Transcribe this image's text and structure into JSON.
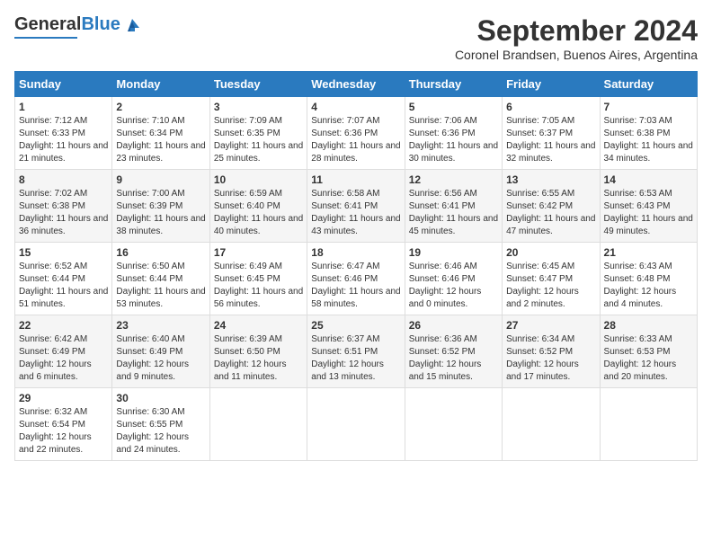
{
  "header": {
    "logo_general": "General",
    "logo_blue": "Blue",
    "title": "September 2024",
    "subtitle": "Coronel Brandsen, Buenos Aires, Argentina"
  },
  "calendar": {
    "days_of_week": [
      "Sunday",
      "Monday",
      "Tuesday",
      "Wednesday",
      "Thursday",
      "Friday",
      "Saturday"
    ],
    "weeks": [
      [
        {
          "day": "1",
          "sunrise": "7:12 AM",
          "sunset": "6:33 PM",
          "daylight": "11 hours and 21 minutes."
        },
        {
          "day": "2",
          "sunrise": "7:10 AM",
          "sunset": "6:34 PM",
          "daylight": "11 hours and 23 minutes."
        },
        {
          "day": "3",
          "sunrise": "7:09 AM",
          "sunset": "6:35 PM",
          "daylight": "11 hours and 25 minutes."
        },
        {
          "day": "4",
          "sunrise": "7:07 AM",
          "sunset": "6:36 PM",
          "daylight": "11 hours and 28 minutes."
        },
        {
          "day": "5",
          "sunrise": "7:06 AM",
          "sunset": "6:36 PM",
          "daylight": "11 hours and 30 minutes."
        },
        {
          "day": "6",
          "sunrise": "7:05 AM",
          "sunset": "6:37 PM",
          "daylight": "11 hours and 32 minutes."
        },
        {
          "day": "7",
          "sunrise": "7:03 AM",
          "sunset": "6:38 PM",
          "daylight": "11 hours and 34 minutes."
        }
      ],
      [
        {
          "day": "8",
          "sunrise": "7:02 AM",
          "sunset": "6:38 PM",
          "daylight": "11 hours and 36 minutes."
        },
        {
          "day": "9",
          "sunrise": "7:00 AM",
          "sunset": "6:39 PM",
          "daylight": "11 hours and 38 minutes."
        },
        {
          "day": "10",
          "sunrise": "6:59 AM",
          "sunset": "6:40 PM",
          "daylight": "11 hours and 40 minutes."
        },
        {
          "day": "11",
          "sunrise": "6:58 AM",
          "sunset": "6:41 PM",
          "daylight": "11 hours and 43 minutes."
        },
        {
          "day": "12",
          "sunrise": "6:56 AM",
          "sunset": "6:41 PM",
          "daylight": "11 hours and 45 minutes."
        },
        {
          "day": "13",
          "sunrise": "6:55 AM",
          "sunset": "6:42 PM",
          "daylight": "11 hours and 47 minutes."
        },
        {
          "day": "14",
          "sunrise": "6:53 AM",
          "sunset": "6:43 PM",
          "daylight": "11 hours and 49 minutes."
        }
      ],
      [
        {
          "day": "15",
          "sunrise": "6:52 AM",
          "sunset": "6:44 PM",
          "daylight": "11 hours and 51 minutes."
        },
        {
          "day": "16",
          "sunrise": "6:50 AM",
          "sunset": "6:44 PM",
          "daylight": "11 hours and 53 minutes."
        },
        {
          "day": "17",
          "sunrise": "6:49 AM",
          "sunset": "6:45 PM",
          "daylight": "11 hours and 56 minutes."
        },
        {
          "day": "18",
          "sunrise": "6:47 AM",
          "sunset": "6:46 PM",
          "daylight": "11 hours and 58 minutes."
        },
        {
          "day": "19",
          "sunrise": "6:46 AM",
          "sunset": "6:46 PM",
          "daylight": "12 hours and 0 minutes."
        },
        {
          "day": "20",
          "sunrise": "6:45 AM",
          "sunset": "6:47 PM",
          "daylight": "12 hours and 2 minutes."
        },
        {
          "day": "21",
          "sunrise": "6:43 AM",
          "sunset": "6:48 PM",
          "daylight": "12 hours and 4 minutes."
        }
      ],
      [
        {
          "day": "22",
          "sunrise": "6:42 AM",
          "sunset": "6:49 PM",
          "daylight": "12 hours and 6 minutes."
        },
        {
          "day": "23",
          "sunrise": "6:40 AM",
          "sunset": "6:49 PM",
          "daylight": "12 hours and 9 minutes."
        },
        {
          "day": "24",
          "sunrise": "6:39 AM",
          "sunset": "6:50 PM",
          "daylight": "12 hours and 11 minutes."
        },
        {
          "day": "25",
          "sunrise": "6:37 AM",
          "sunset": "6:51 PM",
          "daylight": "12 hours and 13 minutes."
        },
        {
          "day": "26",
          "sunrise": "6:36 AM",
          "sunset": "6:52 PM",
          "daylight": "12 hours and 15 minutes."
        },
        {
          "day": "27",
          "sunrise": "6:34 AM",
          "sunset": "6:52 PM",
          "daylight": "12 hours and 17 minutes."
        },
        {
          "day": "28",
          "sunrise": "6:33 AM",
          "sunset": "6:53 PM",
          "daylight": "12 hours and 20 minutes."
        }
      ],
      [
        {
          "day": "29",
          "sunrise": "6:32 AM",
          "sunset": "6:54 PM",
          "daylight": "12 hours and 22 minutes."
        },
        {
          "day": "30",
          "sunrise": "6:30 AM",
          "sunset": "6:55 PM",
          "daylight": "12 hours and 24 minutes."
        },
        null,
        null,
        null,
        null,
        null
      ]
    ]
  }
}
